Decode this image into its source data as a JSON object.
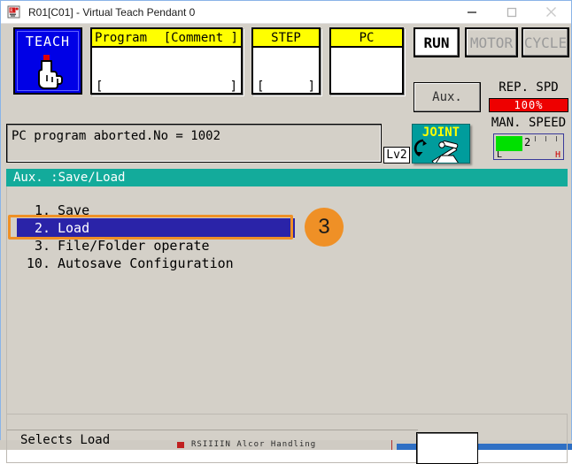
{
  "window": {
    "title": "R01[C01] - Virtual Teach Pendant 0",
    "app_icon": "robot-app-icon",
    "minimize_label": "minimize-icon",
    "maximize_label": "maximize-icon",
    "close_label": "close-icon"
  },
  "pendant": {
    "teach": {
      "label": "TEACH",
      "icon": "pointing-hand-icon"
    },
    "fields": [
      {
        "id": "program",
        "head_left": "Program",
        "head_right": "[Comment ]",
        "bracket_left": "[",
        "bracket_right": "]",
        "value": ""
      },
      {
        "id": "step",
        "head": "STEP",
        "bracket_left": "[",
        "bracket_right": "]",
        "value": ""
      },
      {
        "id": "pc",
        "head": "PC",
        "value": ""
      }
    ],
    "state_buttons": [
      {
        "label": "RUN",
        "state": "on"
      },
      {
        "label": "MOTOR",
        "state": "off"
      },
      {
        "label": "CYCLE",
        "state": "off"
      }
    ],
    "aux_button": "Aux.",
    "rep_spd": {
      "label": "REP. SPD",
      "value": "100%"
    },
    "man_speed": {
      "label": "MAN. SPEED",
      "value": "2",
      "low_mark": "L",
      "high_mark": "H",
      "fill_color": "#00e000"
    },
    "message": {
      "text": "PC program aborted.No = 1002",
      "level_badge": "Lv2"
    },
    "joint": {
      "label": "JOINT",
      "icon": "robot-arm-joint-icon",
      "background": "#009c9c"
    }
  },
  "menu": {
    "header": "Aux. :Save/Load",
    "items": [
      {
        "num": "1.",
        "label": "Save",
        "selected": false
      },
      {
        "num": "2.",
        "label": "Load",
        "selected": true
      },
      {
        "num": "3.",
        "label": "File/Folder operate",
        "selected": false
      },
      {
        "num": "10.",
        "label": "Autosave Configuration",
        "selected": false
      }
    ]
  },
  "annotation": {
    "step_number": "3",
    "color": "#ef9026"
  },
  "status": {
    "text": "Selects Load",
    "input_value": ""
  },
  "background": {
    "taskbar_title": "RSIIIIN Alcor Handling"
  }
}
